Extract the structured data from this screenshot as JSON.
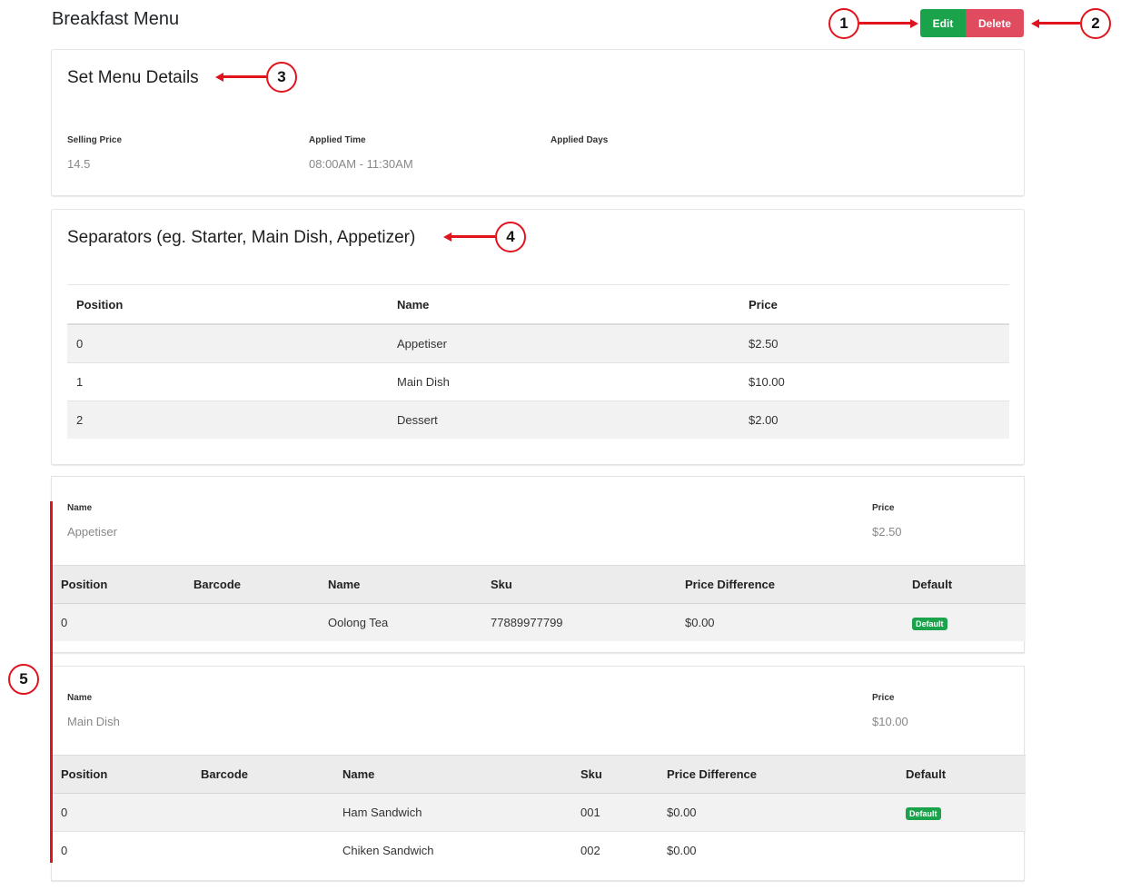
{
  "page": {
    "title": "Breakfast Menu"
  },
  "actions": {
    "edit_label": "Edit",
    "delete_label": "Delete"
  },
  "set_menu": {
    "title": "Set Menu Details",
    "selling_price_label": "Selling Price",
    "selling_price": "14.5",
    "applied_time_label": "Applied Time",
    "applied_time": "08:00AM - 11:30AM",
    "applied_days_label": "Applied Days",
    "applied_days": ""
  },
  "separators": {
    "title": "Separators (eg. Starter, Main Dish, Appetizer)",
    "columns": [
      "Position",
      "Name",
      "Price"
    ],
    "rows": [
      {
        "position": "0",
        "name": "Appetiser",
        "price": "$2.50"
      },
      {
        "position": "1",
        "name": "Main Dish",
        "price": "$10.00"
      },
      {
        "position": "2",
        "name": "Dessert",
        "price": "$2.00"
      }
    ]
  },
  "groups": [
    {
      "name_label": "Name",
      "name": "Appetiser",
      "price_label": "Price",
      "price": "$2.50",
      "columns": [
        "Position",
        "Barcode",
        "Name",
        "Sku",
        "Price Difference",
        "Default"
      ],
      "items": [
        {
          "position": "0",
          "barcode": "",
          "name": "Oolong Tea",
          "sku": "77889977799",
          "price_difference": "$0.00",
          "default": "Default"
        }
      ]
    },
    {
      "name_label": "Name",
      "name": "Main Dish",
      "price_label": "Price",
      "price": "$10.00",
      "columns": [
        "Position",
        "Barcode",
        "Name",
        "Sku",
        "Price Difference",
        "Default"
      ],
      "items": [
        {
          "position": "0",
          "barcode": "",
          "name": "Ham Sandwich",
          "sku": "001",
          "price_difference": "$0.00",
          "default": "Default"
        },
        {
          "position": "0",
          "barcode": "",
          "name": "Chiken Sandwich",
          "sku": "002",
          "price_difference": "$0.00",
          "default": ""
        }
      ]
    }
  ],
  "annotations": [
    "1",
    "2",
    "3",
    "4",
    "5"
  ],
  "colors": {
    "accent_green": "#1aa34a",
    "danger_red": "#e04b5f",
    "annotation_red": "#e0141c"
  }
}
